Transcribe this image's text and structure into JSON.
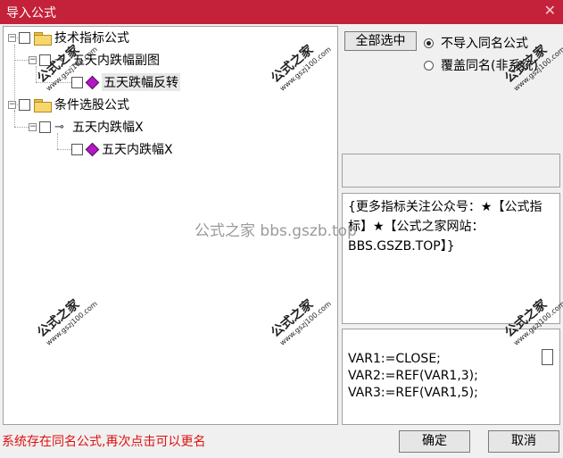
{
  "window": {
    "title": "导入公式",
    "close_icon": "close-icon"
  },
  "tree": {
    "nodes": [
      {
        "label": "技术指标公式",
        "kind": "folder",
        "expander": "−"
      },
      {
        "label": "五天内跌幅副图",
        "kind": "key",
        "expander": "−"
      },
      {
        "label": "五天跌幅反转",
        "kind": "formula"
      },
      {
        "label": "条件选股公式",
        "kind": "folder",
        "expander": "−"
      },
      {
        "label": "五天内跌幅X",
        "kind": "key",
        "expander": "−"
      },
      {
        "label": "五天内跌幅X",
        "kind": "formula"
      }
    ]
  },
  "options": {
    "select_all": "全部选中",
    "no_import_same": "不导入同名公式",
    "overwrite_same": "覆盖同名(非系统)"
  },
  "note": {
    "text": "{更多指标关注公众号：★【公式指标】★【公式之家网站：BBS.GSZB.TOP】}"
  },
  "code": {
    "lines": [
      "VAR1:=CLOSE;",
      "VAR2:=REF(VAR1,3);",
      "VAR3:=REF(VAR1,5);"
    ]
  },
  "status": {
    "message": "系统存在同名公式,再次点击可以更名"
  },
  "buttons": {
    "ok": "确定",
    "cancel": "取消"
  },
  "watermarks": {
    "stamp": "公式之家",
    "url": "www.gszj100.com",
    "center": "公式之家 bbs.gszb.top"
  },
  "colors": {
    "titlebar": "#c4213a",
    "status_text": "#e01010"
  }
}
